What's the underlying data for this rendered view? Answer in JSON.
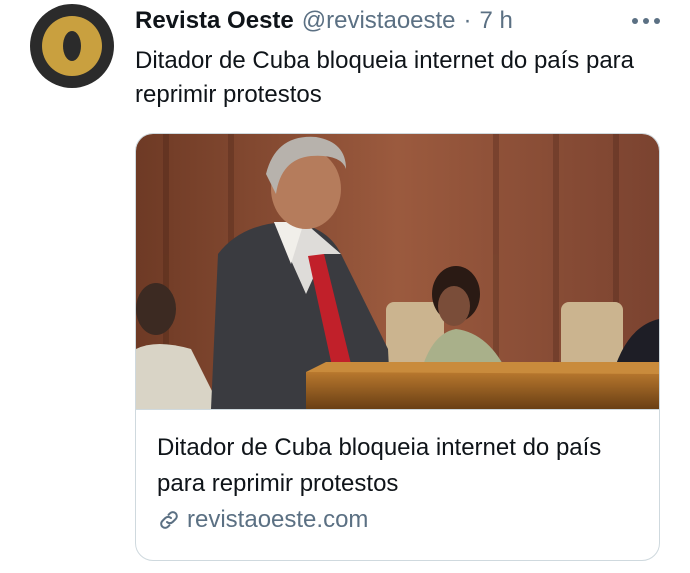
{
  "author": {
    "display_name": "Revista Oeste",
    "handle": "@revistaoeste",
    "separator": "·",
    "time": "7 h"
  },
  "tweet": {
    "text": "Ditador de Cuba bloqueia internet do país para reprimir protestos"
  },
  "card": {
    "title": "Ditador de Cuba bloqueia internet do país para reprimir protestos",
    "domain": "revistaoeste.com"
  },
  "icons": {
    "avatar": "revista-oeste-logo",
    "more": "more-horizontal-icon",
    "link": "link-icon"
  },
  "colors": {
    "secondary_text": "#5b7083",
    "avatar_gold": "#c9a03f",
    "avatar_dark": "#2b2b2b",
    "card_border": "#cfd9de"
  }
}
